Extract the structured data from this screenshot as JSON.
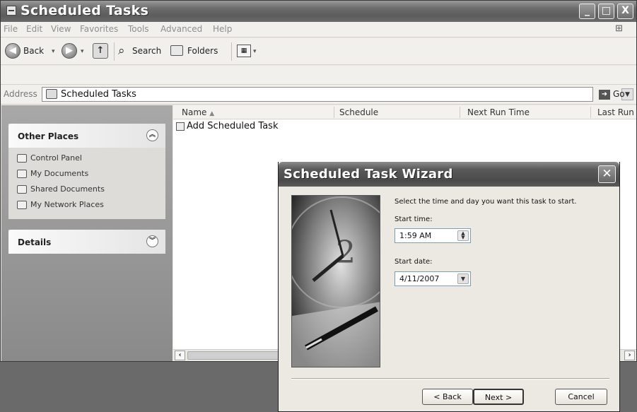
{
  "window": {
    "title": "Scheduled Tasks",
    "controls": {
      "minimize": "_",
      "maximize": "□",
      "close": "X"
    }
  },
  "menu": [
    "File",
    "Edit",
    "View",
    "Favorites",
    "Tools",
    "Advanced",
    "Help"
  ],
  "toolbar": {
    "back_label": "Back",
    "search_label": "Search",
    "folders_label": "Folders"
  },
  "address": {
    "label": "Address",
    "value": "Scheduled Tasks",
    "go_label": "Go"
  },
  "taskpane": {
    "other_places": {
      "title": "Other Places",
      "items": [
        "Control Panel",
        "My Documents",
        "Shared Documents",
        "My Network Places"
      ]
    },
    "details": {
      "title": "Details"
    }
  },
  "filelist": {
    "columns": [
      "Name",
      "Schedule",
      "Next Run Time",
      "Last Run"
    ],
    "rows": [
      {
        "name": "Add Scheduled Task"
      }
    ]
  },
  "wizard": {
    "title": "Scheduled Task Wizard",
    "prompt": "Select the time and day you want this task to start.",
    "start_time_label": "Start time:",
    "start_time_value": "1:59 AM",
    "start_date_label": "Start date:",
    "start_date_value": "4/11/2007",
    "buttons": {
      "back": "< Back",
      "next": "Next >",
      "cancel": "Cancel"
    }
  }
}
